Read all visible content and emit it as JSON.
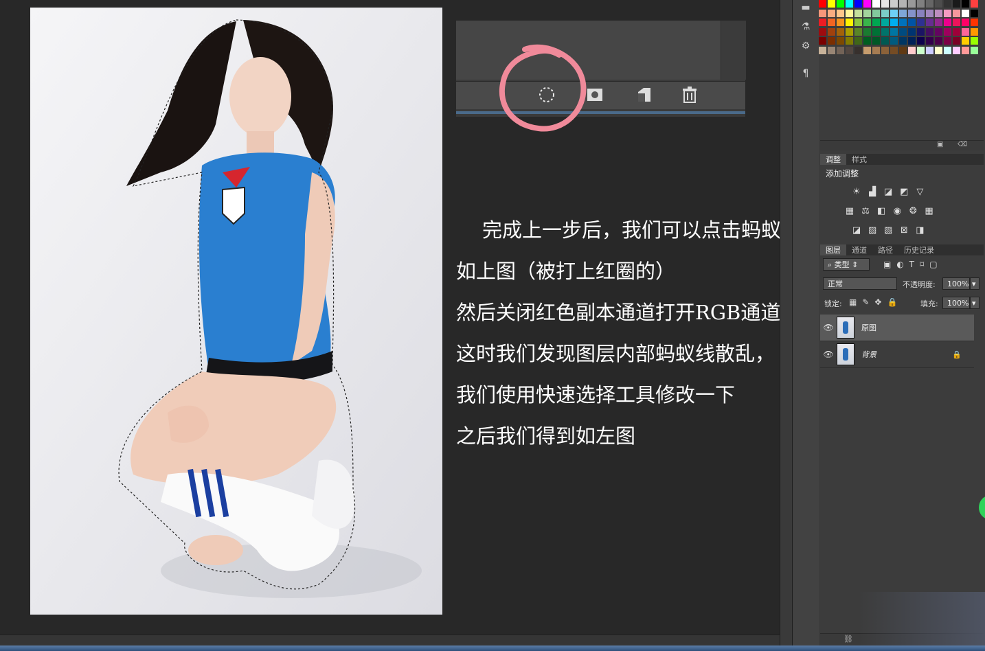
{
  "tutorial": {
    "lines": [
      "完成上一步后，我们可以点击蚂蚁线了，",
      "如上图（被打上红圈的）",
      "然后关闭红色副本通道打开RGB通道并返回图层",
      "这时我们发现图层内部蚂蚁线散乱，",
      "我们使用快速选择工具修改一下",
      "之后我们得到如左图"
    ]
  },
  "channel_panel_inset": {
    "icons": [
      "selection-dotted-icon",
      "mask-icon",
      "new-channel-icon",
      "trash-icon"
    ],
    "highlight_color": "#f08a9a"
  },
  "adjustments_panel": {
    "tabs": [
      "调整",
      "样式"
    ],
    "title": "添加调整",
    "icon_rows": [
      [
        "brightness-icon",
        "levels-icon",
        "curves-icon",
        "exposure-icon",
        "vibrance-icon"
      ],
      [
        "hue-icon",
        "balance-icon",
        "bw-icon",
        "photo-filter-icon",
        "channel-mixer-icon",
        "lookup-icon"
      ],
      [
        "invert-icon",
        "posterize-icon",
        "threshold-icon",
        "gradient-map-icon",
        "selective-color-icon"
      ]
    ]
  },
  "layers_panel": {
    "tabs": [
      "图层",
      "通道",
      "路径",
      "历史记录"
    ],
    "filter_label": "类型",
    "blend_mode": "正常",
    "opacity_label": "不透明度:",
    "opacity_value": "100%",
    "lock_label": "锁定:",
    "fill_label": "填充:",
    "fill_value": "100%",
    "layers": [
      {
        "name": "原图",
        "selected": true,
        "locked": false
      },
      {
        "name": "背景",
        "selected": false,
        "locked": true
      }
    ]
  },
  "swatch_colors": [
    "#ff0000",
    "#ffff00",
    "#00ff00",
    "#00ffff",
    "#0000ff",
    "#ff00ff",
    "#ffffff",
    "#e6e6e6",
    "#cccccc",
    "#b3b3b3",
    "#999999",
    "#808080",
    "#666666",
    "#4d4d4d",
    "#333333",
    "#1a1a1a",
    "#000000",
    "#ff4040",
    "#f7977a",
    "#f9ad81",
    "#fdc68a",
    "#fff79a",
    "#c4df9b",
    "#a2d39c",
    "#82ca9d",
    "#7bcdc8",
    "#6ecff6",
    "#7ea7d8",
    "#8493ca",
    "#8882be",
    "#a187be",
    "#bc8dbf",
    "#f49ac2",
    "#f6989d",
    "#ffffff",
    "#000000",
    "#ed1c24",
    "#f26522",
    "#f7941d",
    "#fff200",
    "#8dc63f",
    "#39b54a",
    "#00a651",
    "#00a99d",
    "#00aeef",
    "#0072bc",
    "#0054a6",
    "#2e3192",
    "#662d91",
    "#92278f",
    "#ec008c",
    "#ed145b",
    "#ff0066",
    "#ff3300",
    "#9e0b0f",
    "#a0410d",
    "#a36209",
    "#aba000",
    "#598527",
    "#1a7b30",
    "#007236",
    "#00746b",
    "#0076a3",
    "#004b80",
    "#003471",
    "#1b1464",
    "#440e62",
    "#630460",
    "#9e005d",
    "#9e0039",
    "#ff6699",
    "#ff9900",
    "#790000",
    "#7b2e00",
    "#7d4900",
    "#827b00",
    "#406618",
    "#005e20",
    "#005826",
    "#005952",
    "#005b7f",
    "#003663",
    "#002157",
    "#0d004c",
    "#32004b",
    "#4b0049",
    "#7b0046",
    "#7a0026",
    "#ffcc00",
    "#99ff00",
    "#c7b299",
    "#998675",
    "#736357",
    "#534741",
    "#37302d",
    "#c69c6d",
    "#a67c52",
    "#8c6239",
    "#754c24",
    "#603913",
    "#ffcccc",
    "#ccffcc",
    "#ccccff",
    "#ffffcc",
    "#ccffff",
    "#ffccff",
    "#ff9999",
    "#99ff99"
  ]
}
